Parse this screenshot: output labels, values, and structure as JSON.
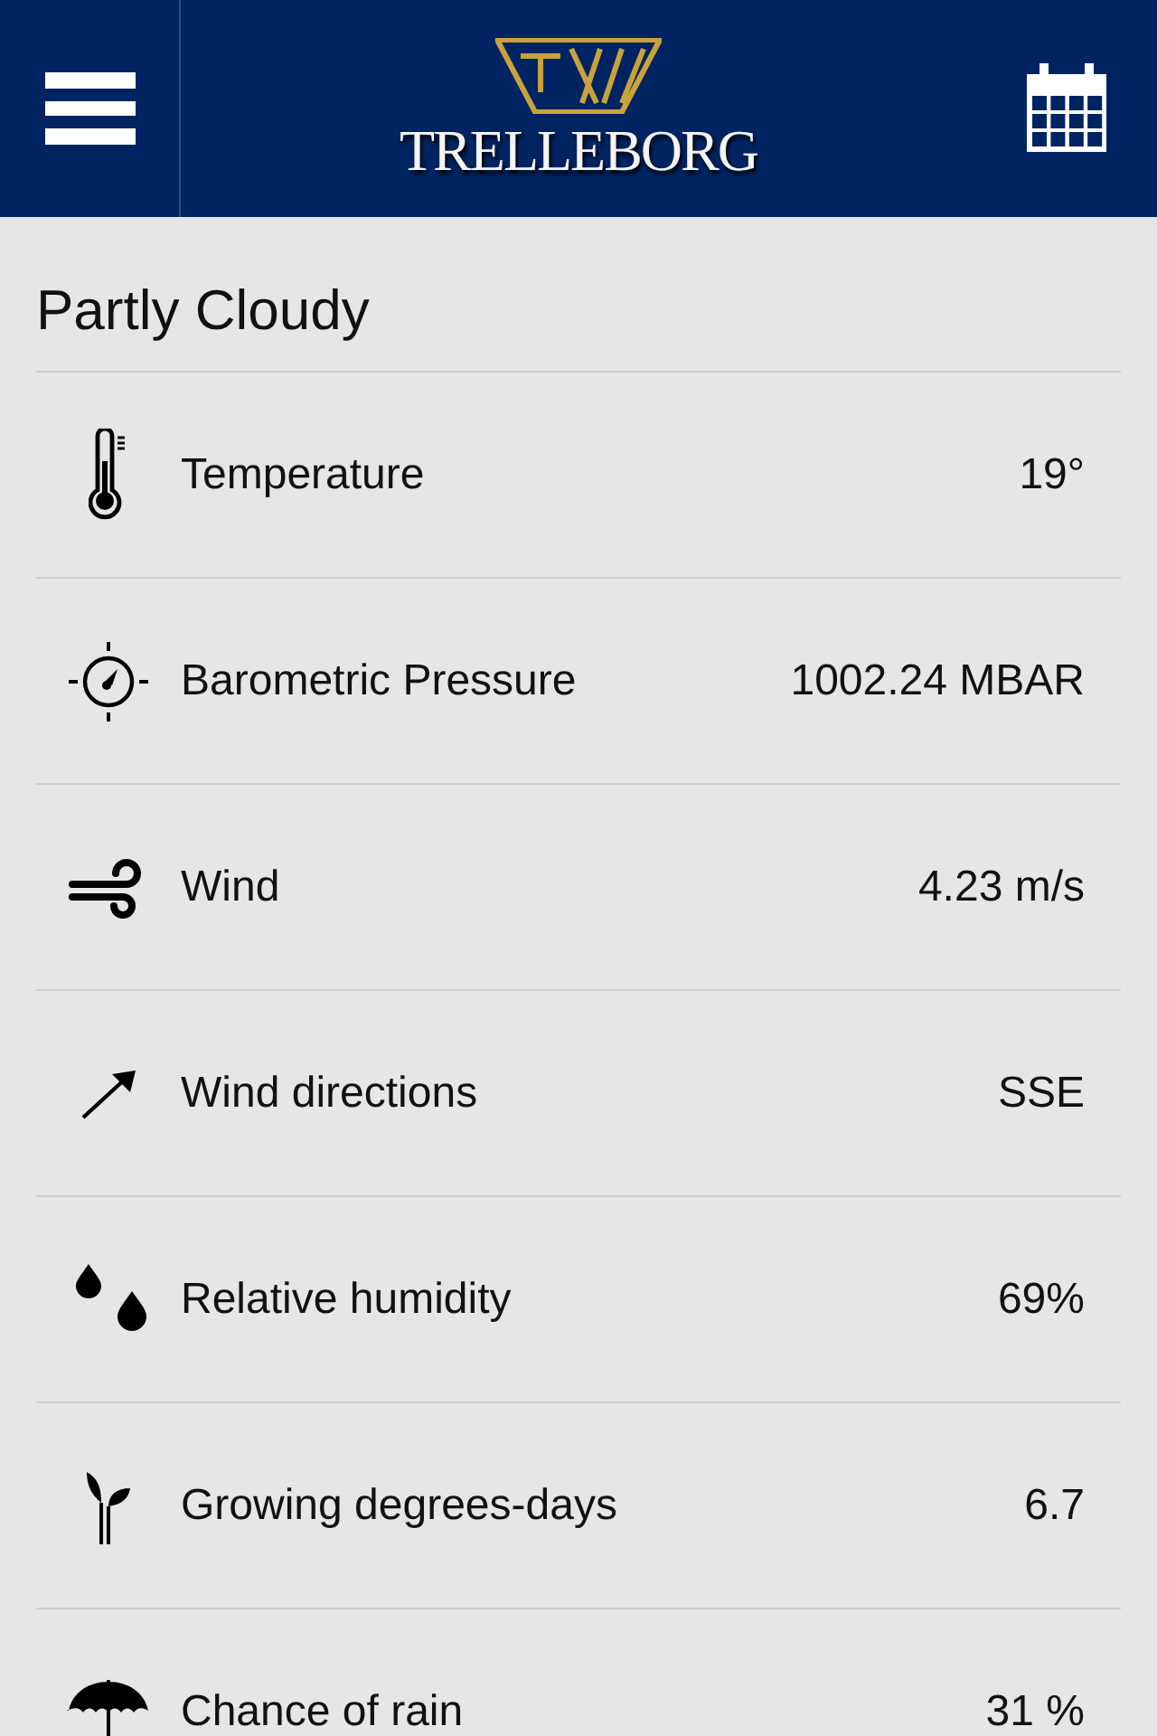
{
  "header": {
    "logo_text": "TRELLEBORG"
  },
  "weather": {
    "condition": "Partly Cloudy",
    "rows": [
      {
        "kind": "thermometer",
        "label": "Temperature",
        "value": "19°"
      },
      {
        "kind": "compass",
        "label": "Barometric Pressure",
        "value": "1002.24 MBAR"
      },
      {
        "kind": "wind",
        "label": "Wind",
        "value": "4.23 m/s"
      },
      {
        "kind": "arrow",
        "label": "Wind directions",
        "value": "SSE"
      },
      {
        "kind": "drops",
        "label": "Relative humidity",
        "value": "69%"
      },
      {
        "kind": "sprout",
        "label": "Growing degrees-days",
        "value": "6.7"
      },
      {
        "kind": "umbrella",
        "label": "Chance of rain",
        "value": "31 %"
      }
    ]
  }
}
